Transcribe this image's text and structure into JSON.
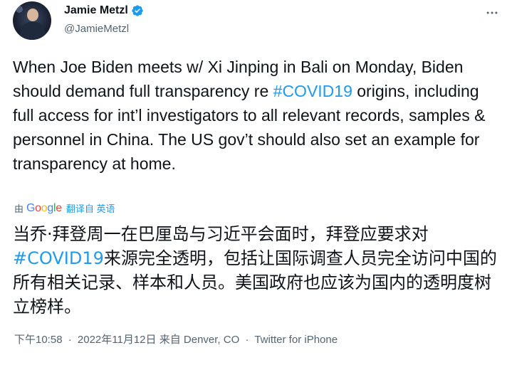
{
  "author": {
    "display_name": "Jamie Metzl",
    "handle": "@JamieMetzl",
    "verified_icon": "verified-badge-icon",
    "avatar_icon": "profile-photo"
  },
  "tweet": {
    "text_before": "When Joe Biden meets w/ Xi Jinping in Bali on Monday, Biden should demand full transparency re ",
    "hashtag": "#COVID19",
    "text_after": " origins, including full access for int’l investigators to all relevant records, samples & personnel in China. The US gov’t should also set an example for transparency at home."
  },
  "translation": {
    "by_label": "由",
    "google_letters": [
      "G",
      "o",
      "o",
      "g",
      "l",
      "e"
    ],
    "link_label": "翻译自 英语",
    "text_before": "当乔·拜登周一在巴厘岛与习近平会面时，拜登应要求对",
    "hashtag": "#COVID19",
    "text_after": "来源完全透明，包括让国际调查人员完全访问中国的所有相关记录、样本和人员。美国政府也应该为国内的透明度树立榜样。"
  },
  "meta": {
    "time": "下午10:58",
    "date": "2022年11月12日",
    "from_label": "来自",
    "location": "Denver, CO",
    "sep": "·",
    "client": "Twitter for iPhone"
  },
  "colors": {
    "accent": "#1d9bf0",
    "text": "#0f1419",
    "secondary": "#536471"
  }
}
